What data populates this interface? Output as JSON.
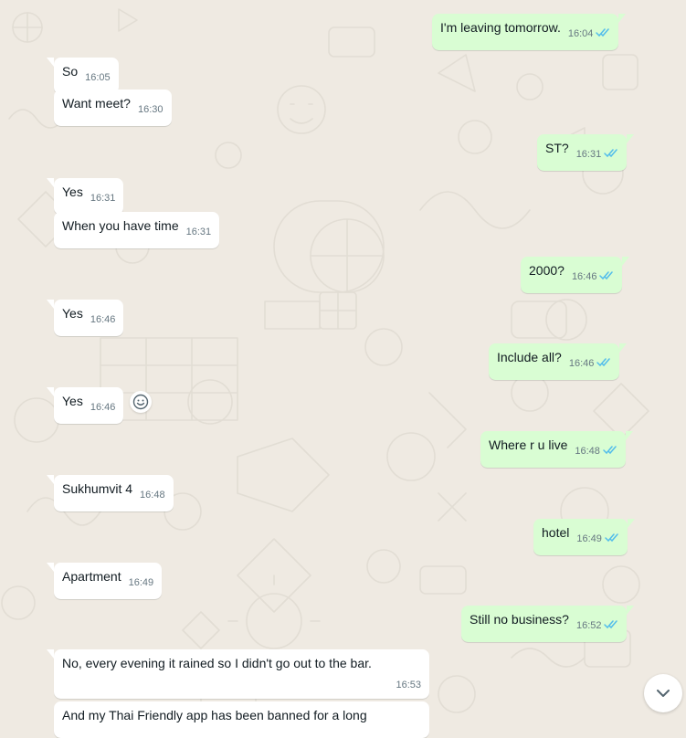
{
  "messages": [
    {
      "text": "I'm leaving tomorrow.",
      "time": "16:04",
      "dir": "out"
    },
    {
      "text": "So",
      "time": "16:05",
      "dir": "in"
    },
    {
      "text": "Want meet?",
      "time": "16:30",
      "dir": "in"
    },
    {
      "text": "ST?",
      "time": "16:31",
      "dir": "out"
    },
    {
      "text": "Yes",
      "time": "16:31",
      "dir": "in"
    },
    {
      "text": "When you have time",
      "time": "16:31",
      "dir": "in"
    },
    {
      "text": "2000?",
      "time": "16:46",
      "dir": "out"
    },
    {
      "text": "Yes",
      "time": "16:46",
      "dir": "in"
    },
    {
      "text": "Include all?",
      "time": "16:46",
      "dir": "out"
    },
    {
      "text": "Yes",
      "time": "16:46",
      "dir": "in"
    },
    {
      "text": "Where r u live",
      "time": "16:48",
      "dir": "out"
    },
    {
      "text": "Sukhumvit 4",
      "time": "16:48",
      "dir": "in"
    },
    {
      "text": "hotel",
      "time": "16:49",
      "dir": "out"
    },
    {
      "text": "Apartment",
      "time": "16:49",
      "dir": "in"
    },
    {
      "text": "Still no business?",
      "time": "16:52",
      "dir": "out"
    },
    {
      "text": "No, every evening it rained so I didn't go out to the bar.",
      "time": "16:53",
      "dir": "in"
    },
    {
      "text": "And my Thai Friendly app has been banned for a long",
      "time": "",
      "dir": "in"
    }
  ],
  "icons": {
    "read_receipt": "double-check-icon",
    "react": "smiley-icon",
    "scroll": "chevron-down-icon"
  },
  "colors": {
    "background": "#efeae2",
    "incoming": "#ffffff",
    "outgoing": "#d9fdd3",
    "read_tick": "#53bdeb"
  }
}
